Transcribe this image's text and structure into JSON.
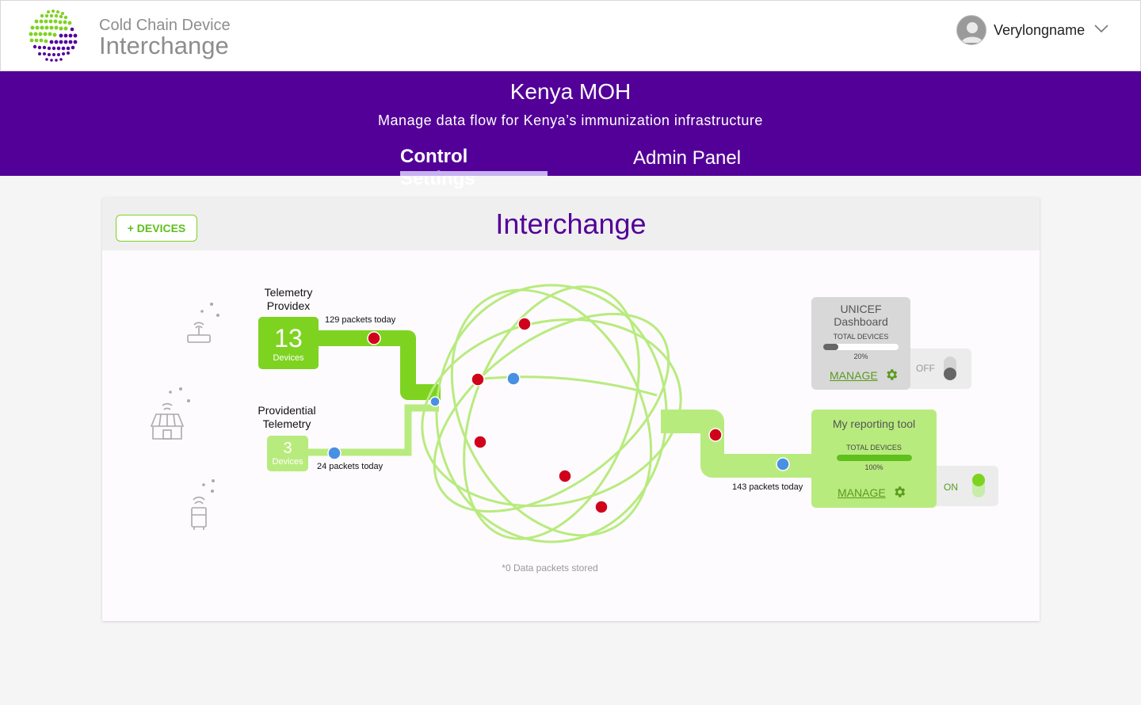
{
  "header": {
    "logo_line1": "Cold Chain Device",
    "logo_line2": "Interchange",
    "username": "Verylongname"
  },
  "band": {
    "org": "Kenya MOH",
    "subtitle": "Manage data flow for Kenya’s immunization infrastructure",
    "tabs": [
      {
        "label": "Control Settings",
        "active": true
      },
      {
        "label": "Admin Panel",
        "active": false
      }
    ]
  },
  "card": {
    "add_button": "+ DEVICES",
    "title": "Interchange",
    "stored_note": "*0 Data packets stored"
  },
  "sources": [
    {
      "name": "Telemetry Providex",
      "count": "13",
      "unit": "Devices",
      "packets": "129 packets today"
    },
    {
      "name": "Providential Telemetry",
      "count": "3",
      "unit": "Devices",
      "packets": "24 packets today"
    }
  ],
  "output_packets": "143 packets today",
  "destinations": [
    {
      "name": "UNICEF Dashboard",
      "total_label": "TOTAL DEVICES",
      "progress": 0.2,
      "progress_label": "20%",
      "manage_label": "MANAGE",
      "toggle_label": "OFF",
      "enabled": false
    },
    {
      "name": "My reporting tool",
      "total_label": "TOTAL DEVICES",
      "progress": 1.0,
      "progress_label": "100%",
      "manage_label": "MANAGE",
      "toggle_label": "ON",
      "enabled": true
    }
  ],
  "colors": {
    "brand_purple": "#530098",
    "green": "#7ed321",
    "light_green": "#b8eb7e",
    "packet_red": "#d0021b",
    "packet_blue": "#4a90e2"
  }
}
